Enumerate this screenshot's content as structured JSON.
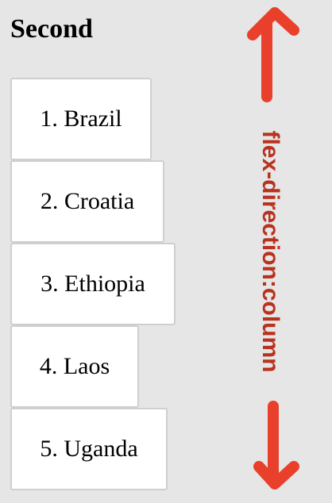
{
  "heading": "Second",
  "items": [
    {
      "label": "1. Brazil"
    },
    {
      "label": "2. Croatia"
    },
    {
      "label": "3. Ethiopia"
    },
    {
      "label": "4. Laos"
    },
    {
      "label": "5. Uganda"
    }
  ],
  "annotation": {
    "label": "flex-direction:column",
    "arrow_color": "#e8402a",
    "text_color": "#b8321e"
  },
  "colors": {
    "background": "#e6e6e6",
    "item_background": "#ffffff",
    "item_border": "#cfcfcf"
  }
}
